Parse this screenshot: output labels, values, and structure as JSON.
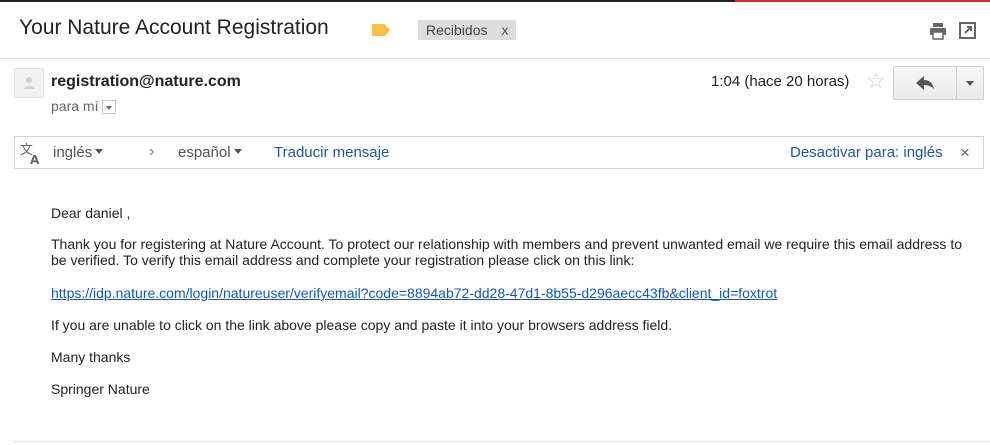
{
  "email": {
    "subject": "Your Nature Account Registration",
    "label_chip": "Recibidos",
    "label_chip_close": "x",
    "sender": "registration@nature.com",
    "to_line": "para mí",
    "date": "1:04 (hace 20 horas)"
  },
  "translate": {
    "from_lang": "inglés",
    "to_lang": "español",
    "translate_link": "Traducir mensaje",
    "disable_link": "Desactivar para: inglés",
    "close_symbol": "×"
  },
  "body": {
    "greeting": "Dear daniel ,",
    "paragraph": "Thank you for registering at Nature Account. To protect our relationship with members and prevent unwanted email we require this email address to be verified. To verify this email address and complete your registration please click on this link:",
    "link": "https://idp.nature.com/login/natureuser/verifyemail?code=8894ab72-dd28-47d1-8b55-d296aecc43fb&client_id=foxtrot",
    "fallback": "If you are unable to click on the link above please copy and paste it into your browsers address field.",
    "thanks": "Many thanks",
    "signature": "Springer Nature"
  },
  "icons": {
    "label": "label-tag-icon",
    "print": "print-icon",
    "new_window": "new-window-icon",
    "star": "star-icon",
    "reply": "reply-icon",
    "more": "chevron-down-icon",
    "translate": "translate-icon",
    "close": "close-icon"
  },
  "colors": {
    "label_tag": "#f5c343",
    "link": "#1155cc",
    "chip_bg": "#dddddd"
  }
}
